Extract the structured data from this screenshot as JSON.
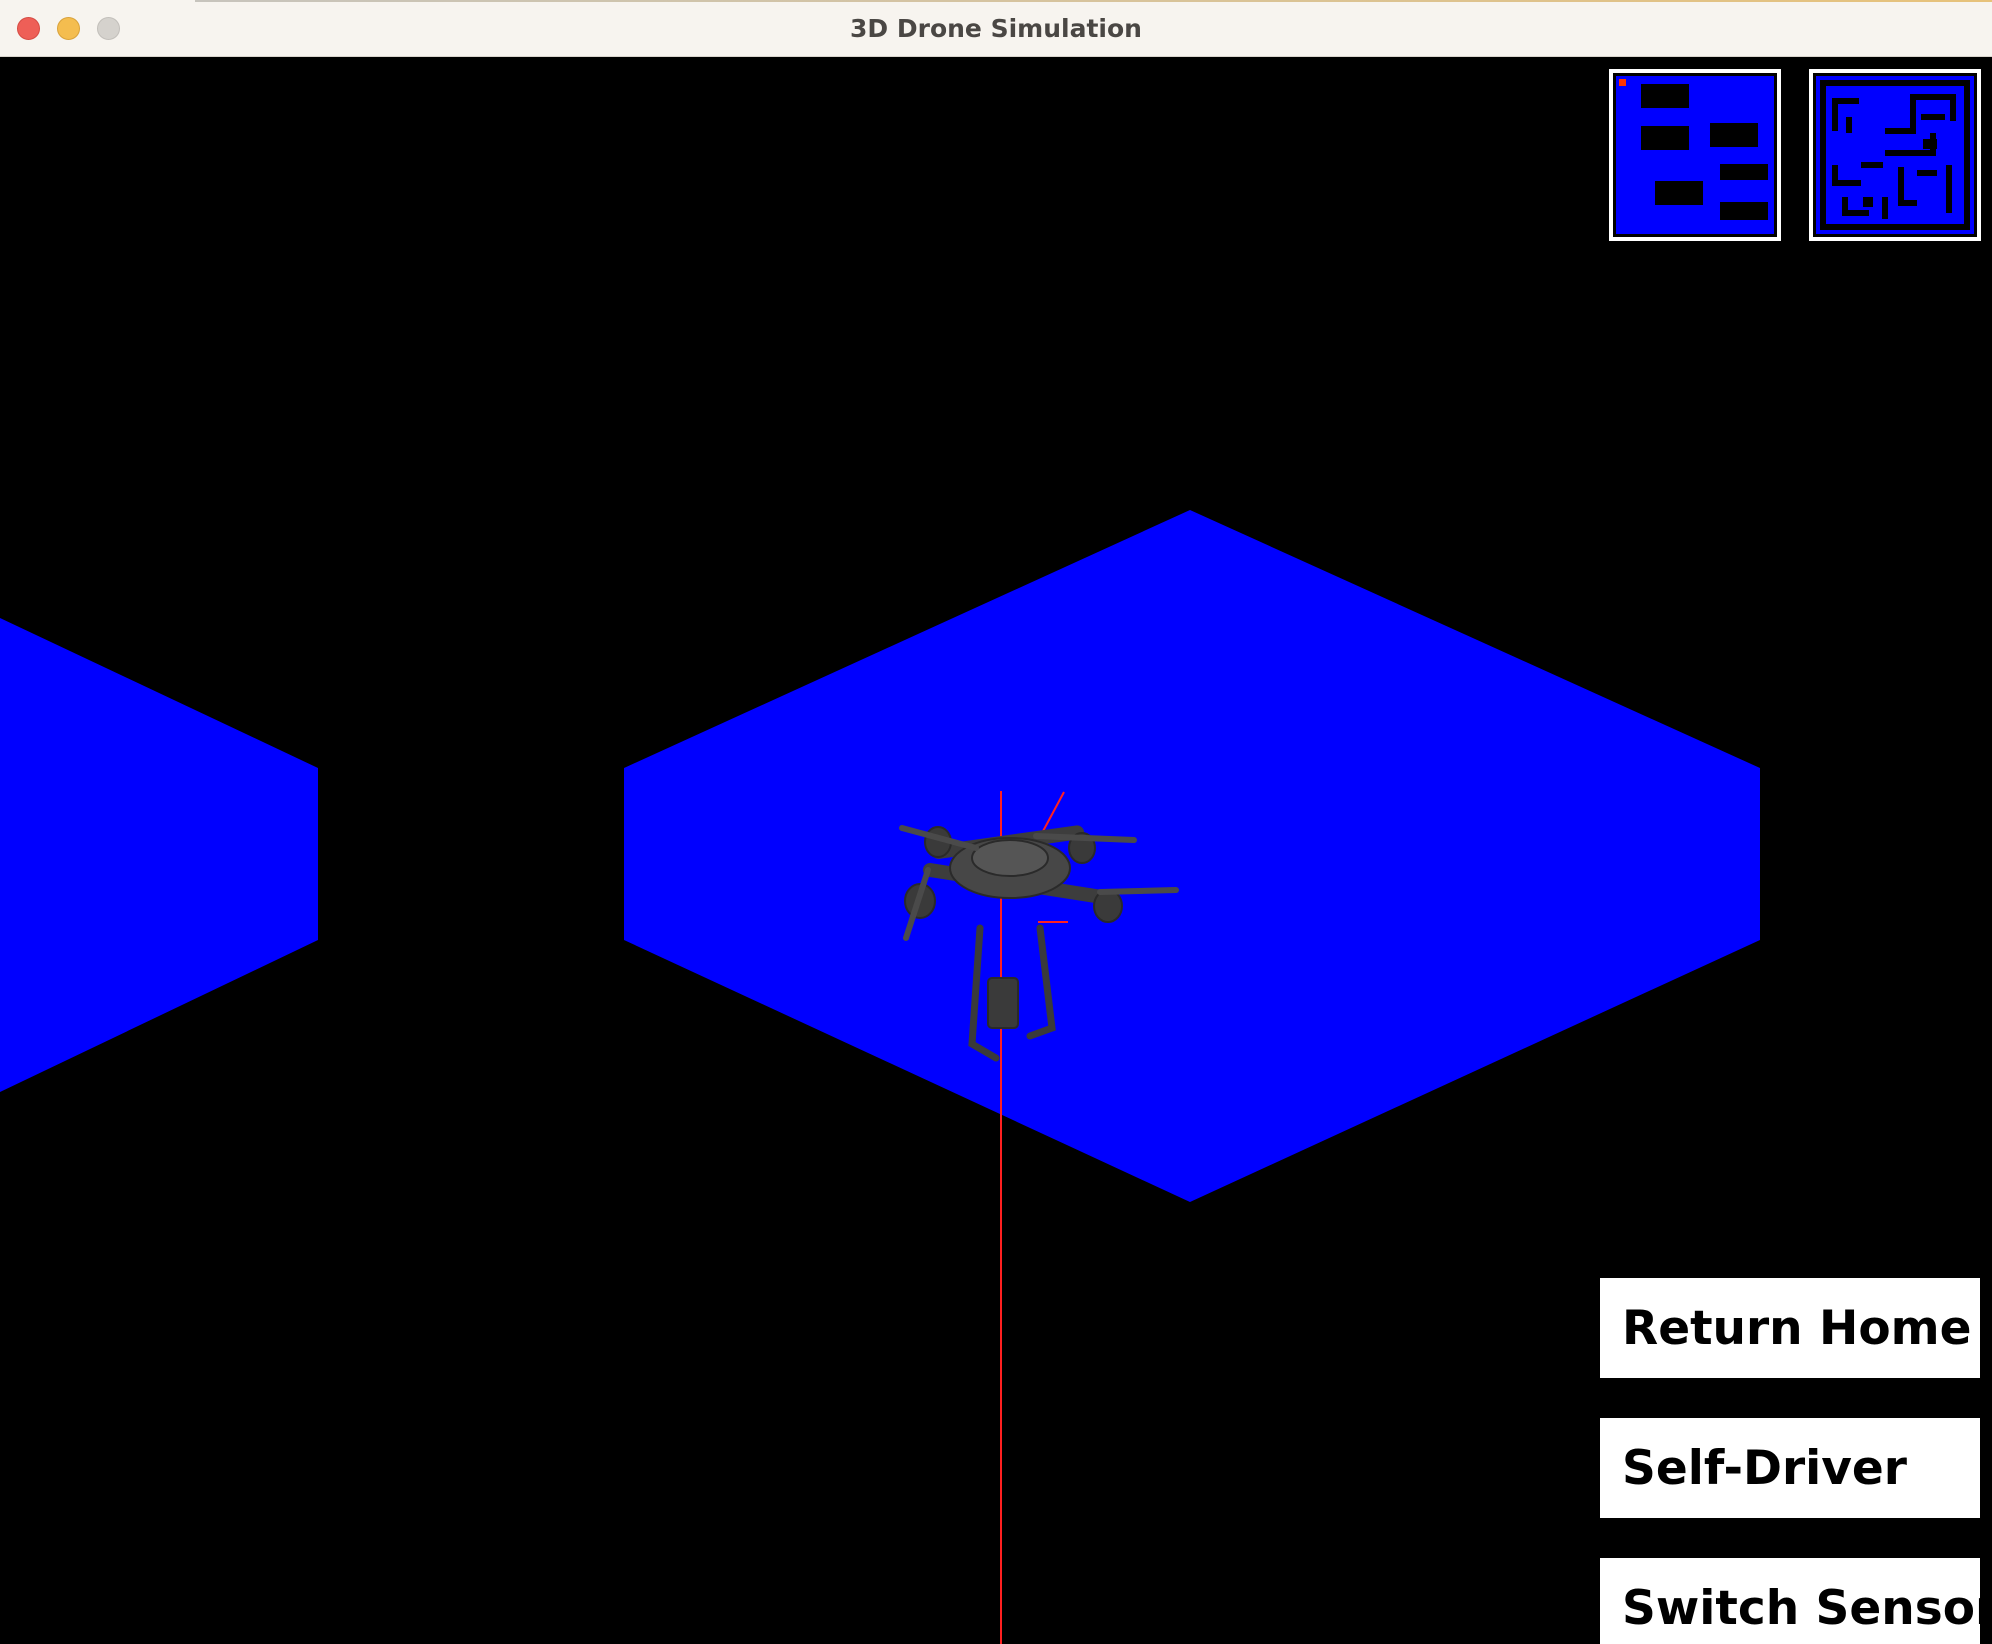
{
  "window": {
    "title": "3D Drone Simulation",
    "controls": [
      "close",
      "minimize",
      "maximize"
    ]
  },
  "colors": {
    "floor": "#0000ff",
    "background": "#000000",
    "axis_line": "#ff2020",
    "drone": "#3a3a3a",
    "button_bg": "#ffffff",
    "button_text": "#000000",
    "minimap_border": "#ffffff",
    "minimap_marker": "#ff3300"
  },
  "scene": {
    "objects": [
      "floor-tile-left",
      "floor-tile-center",
      "drone-model",
      "vertical-axis-line",
      "axis-tick"
    ]
  },
  "minimaps": [
    {
      "id": "obstacles",
      "icon": "obstacle-map-icon"
    },
    {
      "id": "maze",
      "icon": "maze-map-icon"
    }
  ],
  "buttons": {
    "return_home": "Return Home",
    "self_driver": "Self-Driver",
    "switch_sensors": "Switch Sensors"
  }
}
